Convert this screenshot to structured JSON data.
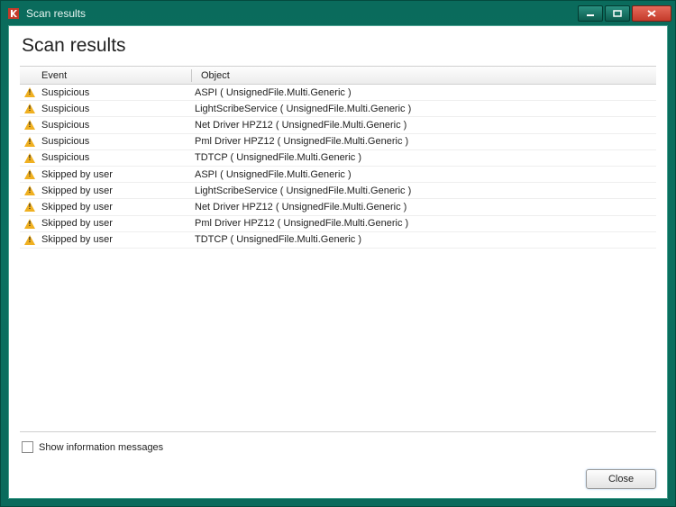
{
  "window": {
    "title": "Scan results"
  },
  "page": {
    "heading": "Scan results"
  },
  "columns": {
    "event": "Event",
    "object": "Object"
  },
  "rows": [
    {
      "event": "Suspicious",
      "object": "ASPI ( UnsignedFile.Multi.Generic )"
    },
    {
      "event": "Suspicious",
      "object": "LightScribeService ( UnsignedFile.Multi.Generic )"
    },
    {
      "event": "Suspicious",
      "object": "Net Driver HPZ12 ( UnsignedFile.Multi.Generic )"
    },
    {
      "event": "Suspicious",
      "object": "Pml Driver HPZ12 ( UnsignedFile.Multi.Generic )"
    },
    {
      "event": "Suspicious",
      "object": "TDTCP ( UnsignedFile.Multi.Generic )"
    },
    {
      "event": "Skipped by user",
      "object": "ASPI ( UnsignedFile.Multi.Generic )"
    },
    {
      "event": "Skipped by user",
      "object": "LightScribeService ( UnsignedFile.Multi.Generic )"
    },
    {
      "event": "Skipped by user",
      "object": "Net Driver HPZ12 ( UnsignedFile.Multi.Generic )"
    },
    {
      "event": "Skipped by user",
      "object": "Pml Driver HPZ12 ( UnsignedFile.Multi.Generic )"
    },
    {
      "event": "Skipped by user",
      "object": "TDTCP ( UnsignedFile.Multi.Generic )"
    }
  ],
  "footer": {
    "show_info_label": "Show information messages",
    "close_label": "Close"
  }
}
